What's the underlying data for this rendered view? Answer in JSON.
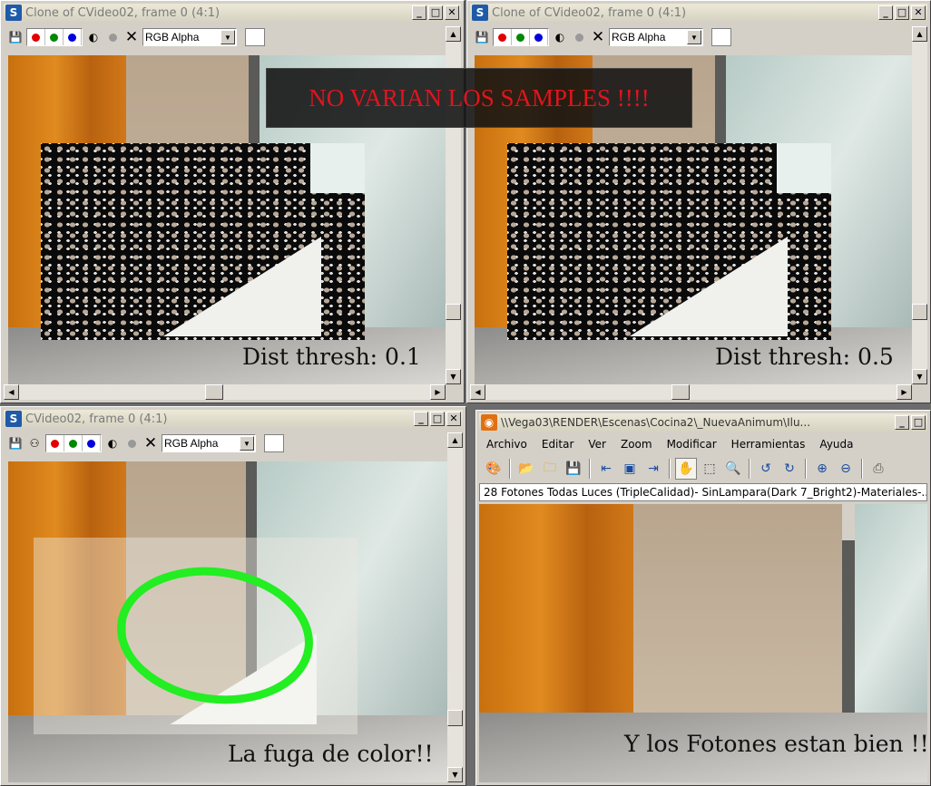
{
  "overlay_banner": "NO VARIAN LOS SAMPLES !!!!",
  "window_tl": {
    "title": "Clone of CVideo02, frame 0 (4:1)",
    "channel": "RGB Alpha",
    "caption": "Dist thresh: 0.1"
  },
  "window_tr": {
    "title": "Clone of CVideo02, frame 0 (4:1)",
    "channel": "RGB Alpha",
    "caption": "Dist thresh: 0.5"
  },
  "window_bl": {
    "title": "CVideo02, frame 0 (4:1)",
    "channel": "RGB Alpha",
    "caption": "La fuga de color!!"
  },
  "window_br": {
    "title": "\\\\Vega03\\RENDER\\Escenas\\Cocina2\\_NuevaAnimum\\Ilu...",
    "menu": [
      "Archivo",
      "Editar",
      "Ver",
      "Zoom",
      "Modificar",
      "Herramientas",
      "Ayuda"
    ],
    "path": "28 Fotones Todas Luces (TripleCalidad)- SinLampara(Dark 7_Bright2)-Materiales-...",
    "caption": "Y los Fotones estan bien !!"
  },
  "icons": {
    "app": "3ds-max-logo-icon",
    "save": "save-icon",
    "red": "red-channel-icon",
    "green": "green-channel-icon",
    "blue": "blue-channel-icon",
    "mono": "monochrome-icon",
    "alpha": "alpha-icon",
    "clear": "clear-icon"
  },
  "colors": {
    "banner_text": "#e0141e",
    "highlight_ring": "#22ee22"
  }
}
